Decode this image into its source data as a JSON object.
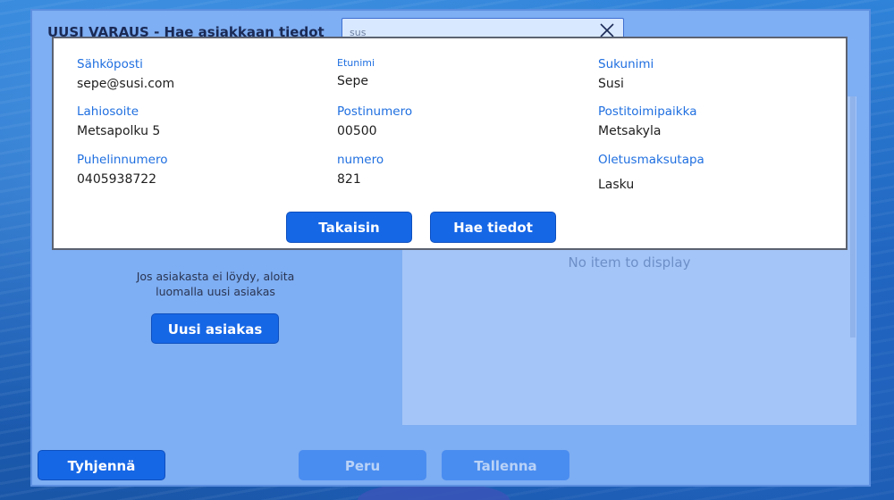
{
  "header": {
    "title": "UUSI VARAUS - Hae asiakkaan tiedot"
  },
  "search": {
    "value": "sus"
  },
  "results": {
    "empty_text": "No item to display"
  },
  "left": {
    "not_found_text": "Jos asiakasta ei löydy, aloita luomalla uusi asiakas",
    "new_customer_label": "Uusi asiakas"
  },
  "footer": {
    "clear_label": "Tyhjennä",
    "cancel_label": "Peru",
    "save_label": "Tallenna"
  },
  "dialog": {
    "email_label": "Sähköposti",
    "email_value": "sepe@susi.com",
    "firstname_label": "Etunimi",
    "firstname_value": "Sepe",
    "lastname_label": "Sukunimi",
    "lastname_value": "Susi",
    "address_label": "Lahiosoite",
    "address_value": "Metsapolku 5",
    "postcode_label": "Postinumero",
    "postcode_value": "00500",
    "city_label": "Postitoimipaikka",
    "city_value": "Metsakyla",
    "phone_label": "Puhelinnumero",
    "phone_value": "0405938722",
    "number_label": "numero",
    "number_value": "821",
    "payment_label": "Oletusmaksutapa",
    "payment_value": "Lasku",
    "back_label": "Takaisin",
    "fetch_label": "Hae tiedot"
  }
}
